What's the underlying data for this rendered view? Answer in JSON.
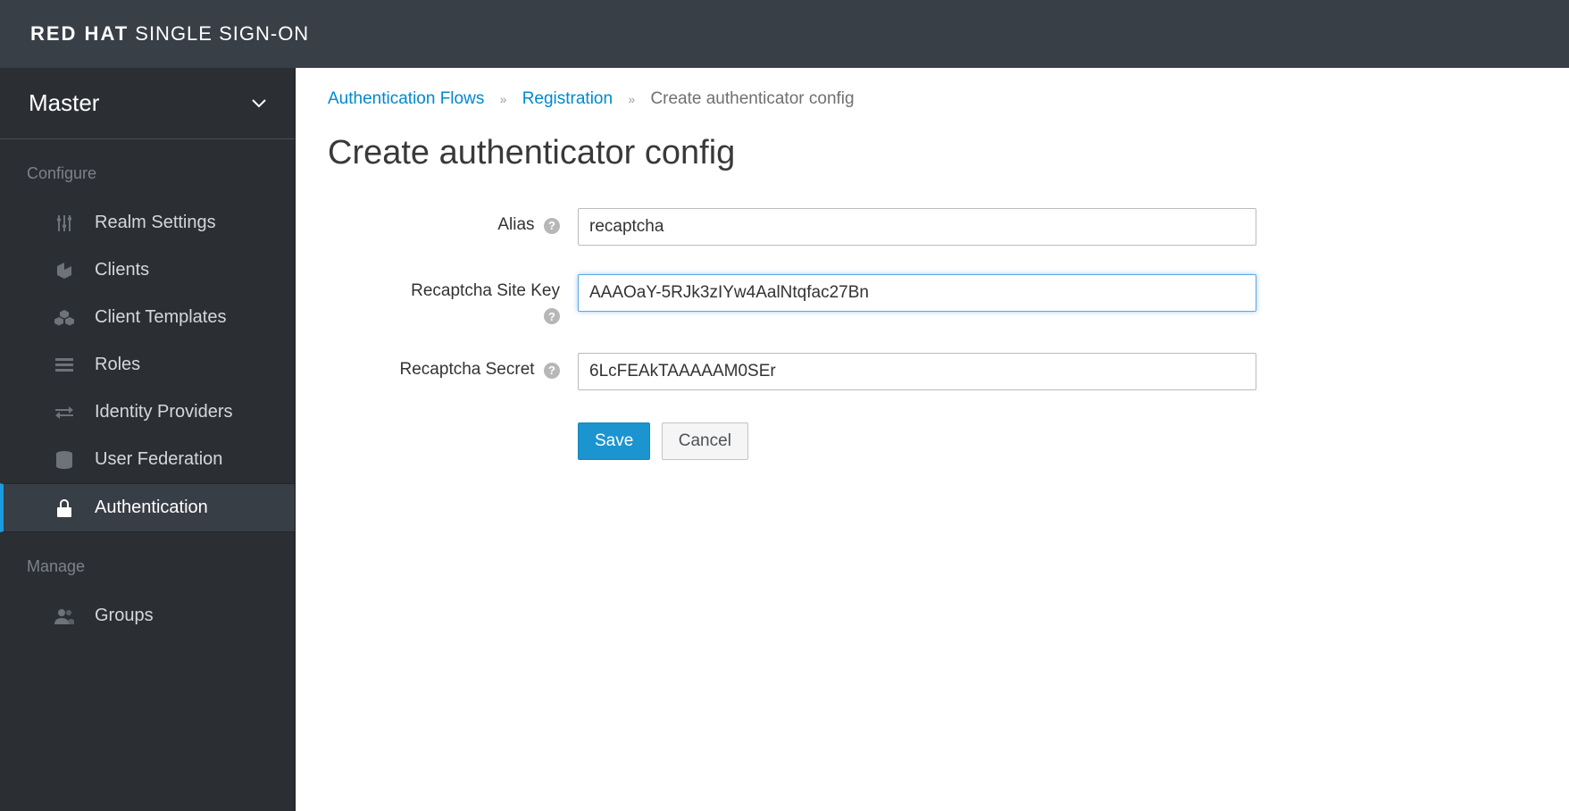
{
  "header": {
    "logo_bold": "RED HAT",
    "logo_light": " SINGLE SIGN-ON"
  },
  "sidebar": {
    "realm_name": "Master",
    "sections": [
      {
        "title": "Configure",
        "items": [
          {
            "icon": "sliders",
            "label": "Realm Settings",
            "active": false
          },
          {
            "icon": "cube",
            "label": "Clients",
            "active": false
          },
          {
            "icon": "cubes",
            "label": "Client Templates",
            "active": false
          },
          {
            "icon": "list",
            "label": "Roles",
            "active": false
          },
          {
            "icon": "exchange",
            "label": "Identity Providers",
            "active": false
          },
          {
            "icon": "database",
            "label": "User Federation",
            "active": false
          },
          {
            "icon": "lock",
            "label": "Authentication",
            "active": true
          }
        ]
      },
      {
        "title": "Manage",
        "items": [
          {
            "icon": "users",
            "label": "Groups",
            "active": false
          }
        ]
      }
    ]
  },
  "breadcrumb": {
    "items": [
      {
        "label": "Authentication Flows",
        "link": true
      },
      {
        "label": "Registration",
        "link": true
      },
      {
        "label": "Create authenticator config",
        "link": false
      }
    ]
  },
  "page": {
    "title": "Create authenticator config"
  },
  "form": {
    "alias": {
      "label": "Alias",
      "value": "recaptcha",
      "help_inline": true
    },
    "site_key": {
      "label": "Recaptcha Site Key",
      "value": "AAAOaY-5RJk3zIYw4AalNtqfac27Bn",
      "help_below": true,
      "focused": true
    },
    "secret": {
      "label": "Recaptcha Secret",
      "value": "6LcFEAkTAAAAAM0SEr",
      "help_inline": true
    },
    "buttons": {
      "save": "Save",
      "cancel": "Cancel"
    }
  }
}
